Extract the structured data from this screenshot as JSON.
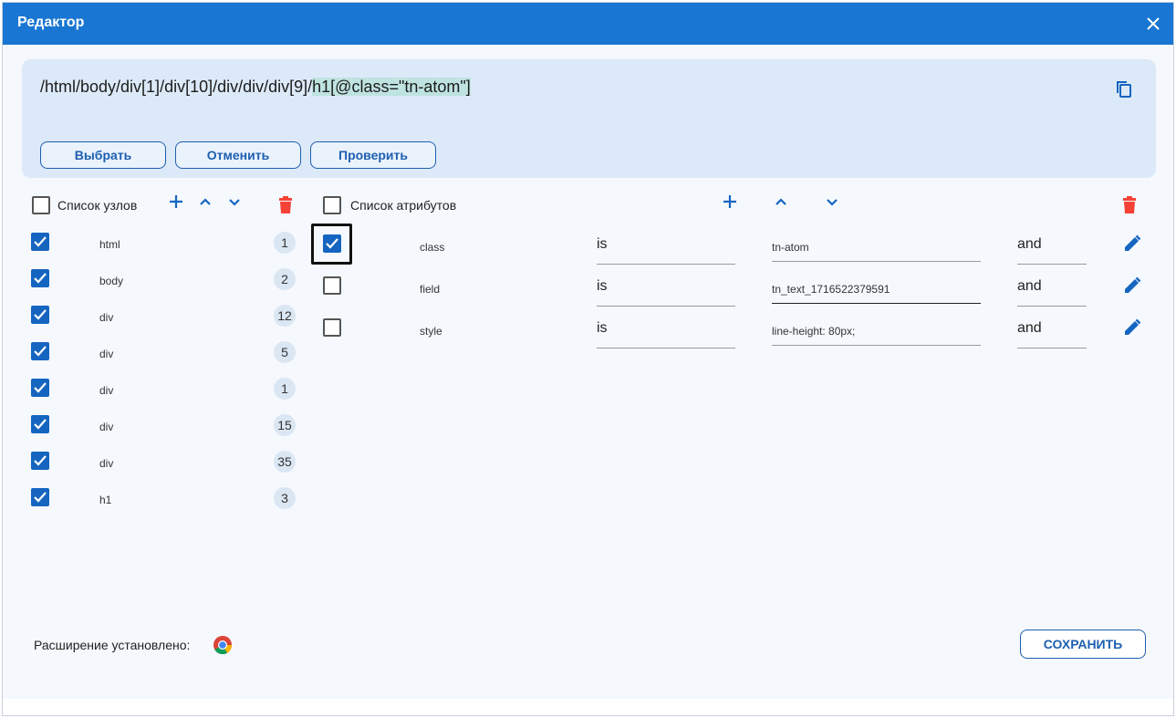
{
  "window": {
    "title": "Редактор"
  },
  "xpath": {
    "prefix": "/html/body/div[1]/div[10]/div/div/div[9]/",
    "highlight": "h1[@class=\"tn-atom\"]"
  },
  "actions": {
    "select": "Выбрать",
    "cancel": "Отменить",
    "check": "Проверить"
  },
  "nodes": {
    "header": "Список узлов",
    "items": [
      {
        "name": "html",
        "count": "1",
        "checked": true
      },
      {
        "name": "body",
        "count": "2",
        "checked": true
      },
      {
        "name": "div",
        "count": "12",
        "checked": true
      },
      {
        "name": "div",
        "count": "5",
        "checked": true
      },
      {
        "name": "div",
        "count": "1",
        "checked": true
      },
      {
        "name": "div",
        "count": "15",
        "checked": true
      },
      {
        "name": "div",
        "count": "35",
        "checked": true
      },
      {
        "name": "h1",
        "count": "3",
        "checked": true
      }
    ]
  },
  "attributes": {
    "header": "Список атрибутов",
    "items": [
      {
        "name": "class",
        "operator": "is",
        "value": "tn-atom",
        "logic": "and",
        "checked": true
      },
      {
        "name": "field",
        "operator": "is",
        "value": "tn_text_1716522379591",
        "logic": "and",
        "checked": false
      },
      {
        "name": "style",
        "operator": "is",
        "value": "line-height: 80px;",
        "logic": "and",
        "checked": false
      }
    ]
  },
  "footer": {
    "extension_label": "Расширение установлено:",
    "save": "СОХРАНИТЬ"
  },
  "icons": {
    "close": "close-icon",
    "copy": "copy-icon",
    "add": "plus-icon",
    "up": "chevron-up-icon",
    "down": "chevron-down-icon",
    "delete": "trash-icon",
    "edit": "pencil-icon",
    "browser": "chrome-icon"
  },
  "colors": {
    "titlebar": "#1976d2",
    "accent": "#1565c0",
    "danger": "#f44336",
    "panel": "#dce9f8"
  }
}
